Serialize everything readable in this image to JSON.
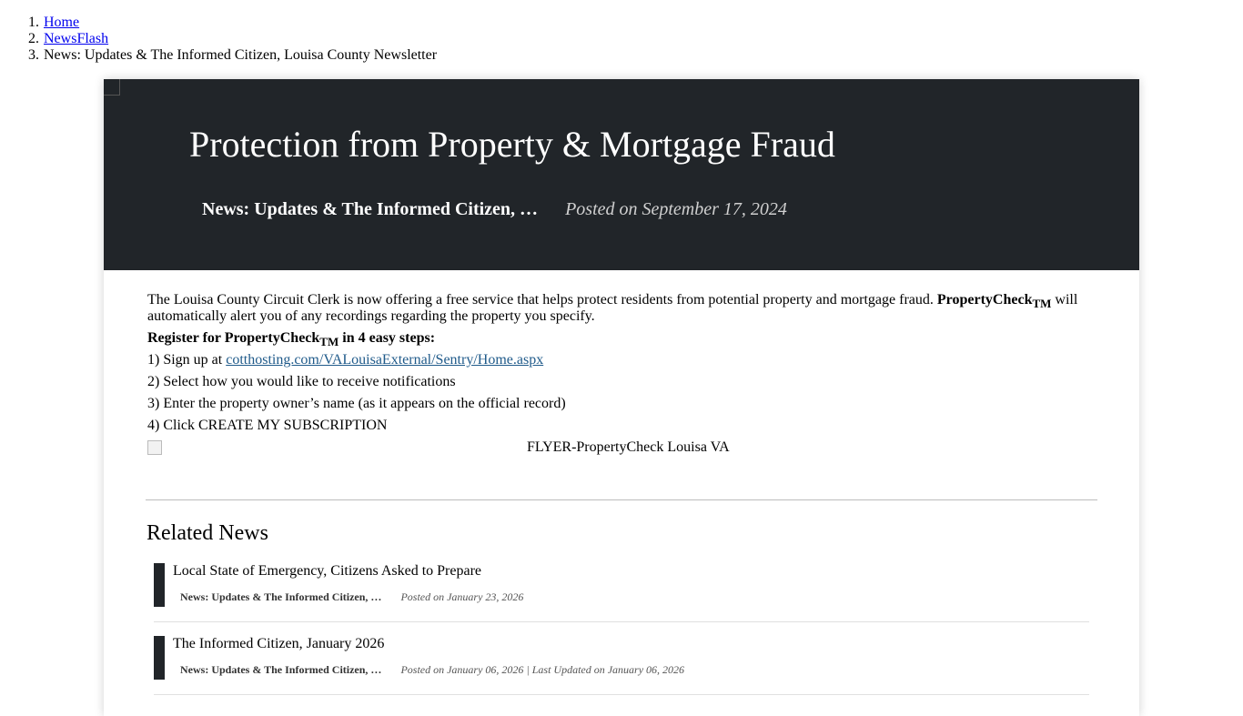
{
  "breadcrumb": [
    {
      "num": "1.",
      "label": "Home",
      "link": true
    },
    {
      "num": "2.",
      "label": "NewsFlash",
      "link": true
    },
    {
      "num": "3.",
      "label": "News: Updates & The Informed Citizen, Louisa County Newsletter",
      "link": false
    }
  ],
  "banner": {
    "title": "Protection from Property & Mortgage Fraud",
    "category": "News: Updates & The Informed Citizen, …",
    "posted": "Posted on September 17, 2024"
  },
  "article": {
    "intro_text": "The Louisa County Circuit Clerk is now offering a free service that helps protect residents from potential property and mortgage fraud.",
    "product_name": "PropertyCheck",
    "tm": "TM",
    "intro_tail": "will automatically alert you of any recordings regarding the property you specify.",
    "register_prefix": "Register for",
    "register_suffix": "in 4 easy steps:",
    "step1_prefix": "1) Sign up at",
    "step1_link": "cotthosting.com/VALouisaExternal/Sentry/Home.aspx",
    "step2": "2) Select how you would like to receive notifications",
    "step3": "3) Enter the property owner’s name (as it appears on the official record)",
    "step4": "4) Click CREATE MY SUBSCRIPTION",
    "flyer_alt": "FLYER-PropertyCheck Louisa VA"
  },
  "related": {
    "heading": "Related News",
    "items": [
      {
        "title": "Local State of Emergency, Citizens Asked to Prepare",
        "category": "News: Updates & The Informed Citizen, …",
        "date": "Posted on January 23, 2026"
      },
      {
        "title": "The Informed Citizen, January 2026",
        "category": "News: Updates & The Informed Citizen, …",
        "date": "Posted on January 06, 2026 | Last Updated on January 06, 2026"
      }
    ]
  }
}
